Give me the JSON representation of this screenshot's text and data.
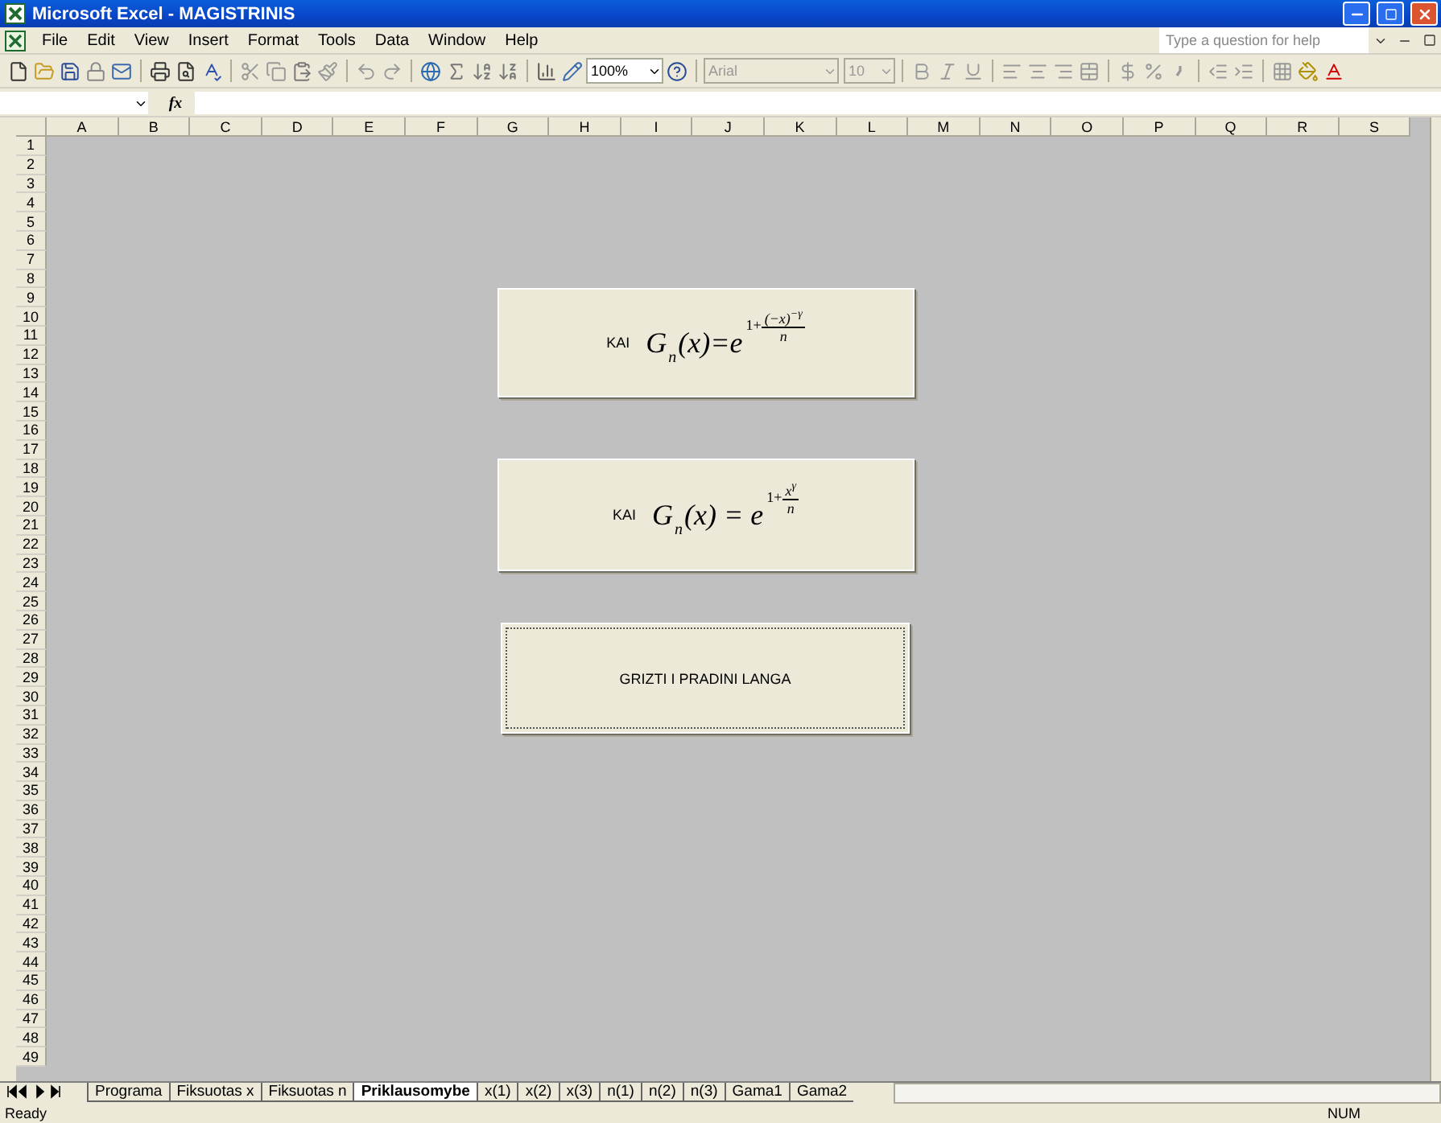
{
  "window": {
    "title": "Microsoft Excel - MAGISTRINIS"
  },
  "menu": [
    "File",
    "Edit",
    "View",
    "Insert",
    "Format",
    "Tools",
    "Data",
    "Window",
    "Help"
  ],
  "help_box": {
    "placeholder": "Type a question for help"
  },
  "standard_toolbar": {
    "zoom": "100%"
  },
  "formatting_toolbar": {
    "font": "Arial",
    "size": "10"
  },
  "formula_bar": {
    "function_label": "fx"
  },
  "sheet": {
    "columns": [
      "A",
      "B",
      "C",
      "D",
      "E",
      "F",
      "G",
      "H",
      "I",
      "J",
      "K",
      "L",
      "M",
      "N",
      "O",
      "P",
      "Q",
      "R",
      "S"
    ],
    "rows": [
      "1",
      "2",
      "3",
      "4",
      "5",
      "6",
      "7",
      "8",
      "9",
      "10",
      "11",
      "12",
      "13",
      "14",
      "15",
      "16",
      "17",
      "18",
      "19",
      "20",
      "21",
      "22",
      "23",
      "24",
      "25",
      "26",
      "27",
      "28",
      "29",
      "30",
      "31",
      "32",
      "33",
      "34",
      "35",
      "36",
      "37",
      "38",
      "39",
      "40",
      "41",
      "42",
      "43",
      "44",
      "45",
      "46",
      "47",
      "48",
      "49"
    ]
  },
  "buttons": [
    {
      "kind": "formula",
      "prefix": "KAI",
      "function": "G",
      "subscript": "n",
      "argument": "(x)=e",
      "exponent_lead": "1+",
      "numerator": "(−x)",
      "numerator_power": "−γ",
      "denominator": "n",
      "focused": false
    },
    {
      "kind": "formula",
      "prefix": "KAI",
      "function": "G",
      "subscript": "n",
      "argument": "(x) = e",
      "exponent_lead": "1+",
      "numerator": "x",
      "numerator_power": "γ",
      "denominator": "n",
      "focused": false
    },
    {
      "kind": "text",
      "label": "GRIZTI I PRADINI LANGA",
      "focused": true
    }
  ],
  "sheet_tabs": [
    {
      "label": "Programa",
      "selected": false
    },
    {
      "label": "Fiksuotas x",
      "selected": false
    },
    {
      "label": "Fiksuotas n",
      "selected": false
    },
    {
      "label": "Priklausomybe",
      "selected": true
    },
    {
      "label": "x(1)",
      "selected": false
    },
    {
      "label": "x(2)",
      "selected": false
    },
    {
      "label": "x(3)",
      "selected": false
    },
    {
      "label": "n(1)",
      "selected": false
    },
    {
      "label": "n(2)",
      "selected": false
    },
    {
      "label": "n(3)",
      "selected": false
    },
    {
      "label": "Gama1",
      "selected": false
    },
    {
      "label": "Gama2",
      "selected": false
    }
  ],
  "status_bar": {
    "status": "Ready",
    "indicator": "NUM"
  }
}
